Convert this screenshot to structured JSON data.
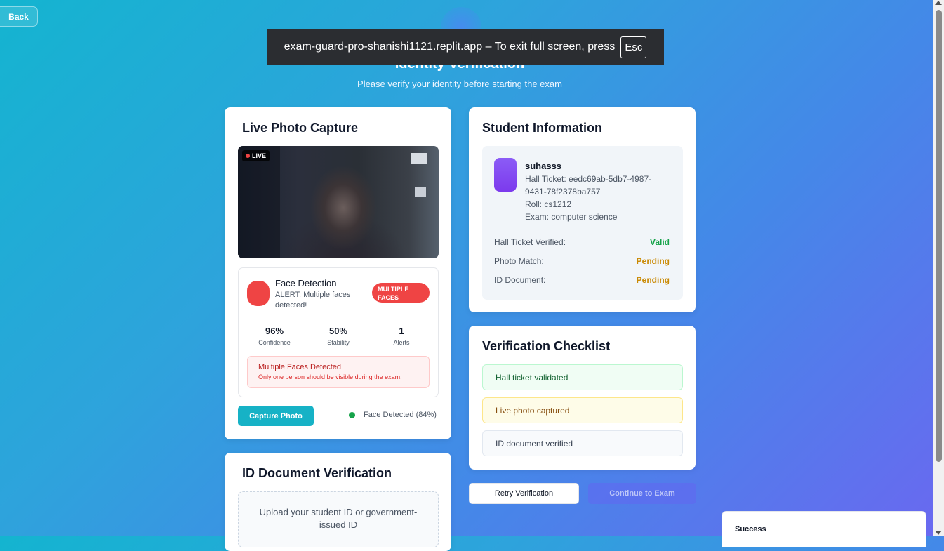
{
  "nav": {
    "back_label": "Back"
  },
  "header": {
    "title": "Identity Verification",
    "subtitle": "Please verify your identity before starting the exam"
  },
  "fullscreen_banner": {
    "message": "exam-guard-pro-shanishi1121.replit.app – To exit full screen, press",
    "key": "Esc"
  },
  "photo_capture": {
    "title": "Live Photo Capture",
    "live_badge": "LIVE",
    "detection": {
      "title": "Face Detection",
      "alert": "ALERT: Multiple faces detected!",
      "badge": "MULTIPLE FACES",
      "stats": [
        {
          "value": "96%",
          "label": "Confidence"
        },
        {
          "value": "50%",
          "label": "Stability"
        },
        {
          "value": "1",
          "label": "Alerts"
        }
      ],
      "warning_title": "Multiple Faces Detected",
      "warning_text": "Only one person should be visible during the exam."
    },
    "capture_button": "Capture Photo",
    "face_status": "Face Detected (84%)"
  },
  "id_document": {
    "title": "ID Document Verification",
    "upload_text": "Upload your student ID or government-issued ID"
  },
  "student_info": {
    "title": "Student Information",
    "name": "suhasss",
    "hall_ticket": "Hall Ticket: eedc69ab-5db7-4987-9431-78f2378ba757",
    "roll": "Roll: cs1212",
    "exam": "Exam: computer science",
    "verifications": [
      {
        "label": "Hall Ticket Verified:",
        "status": "Valid"
      },
      {
        "label": "Photo Match:",
        "status": "Pending"
      },
      {
        "label": "ID Document:",
        "status": "Pending"
      }
    ]
  },
  "checklist": {
    "title": "Verification Checklist",
    "items": [
      {
        "label": "Hall ticket validated",
        "state": "done"
      },
      {
        "label": "Live photo captured",
        "state": "pending"
      },
      {
        "label": "ID document verified",
        "state": "todo"
      }
    ]
  },
  "actions": {
    "retry": "Retry Verification",
    "continue": "Continue to Exam"
  },
  "toast": {
    "title": "Success"
  },
  "colors": {
    "accent": "#16b2c6",
    "danger": "#ef4444",
    "success": "#16a34a",
    "warning": "#ca8a04",
    "avatar": "#7c3aed"
  }
}
